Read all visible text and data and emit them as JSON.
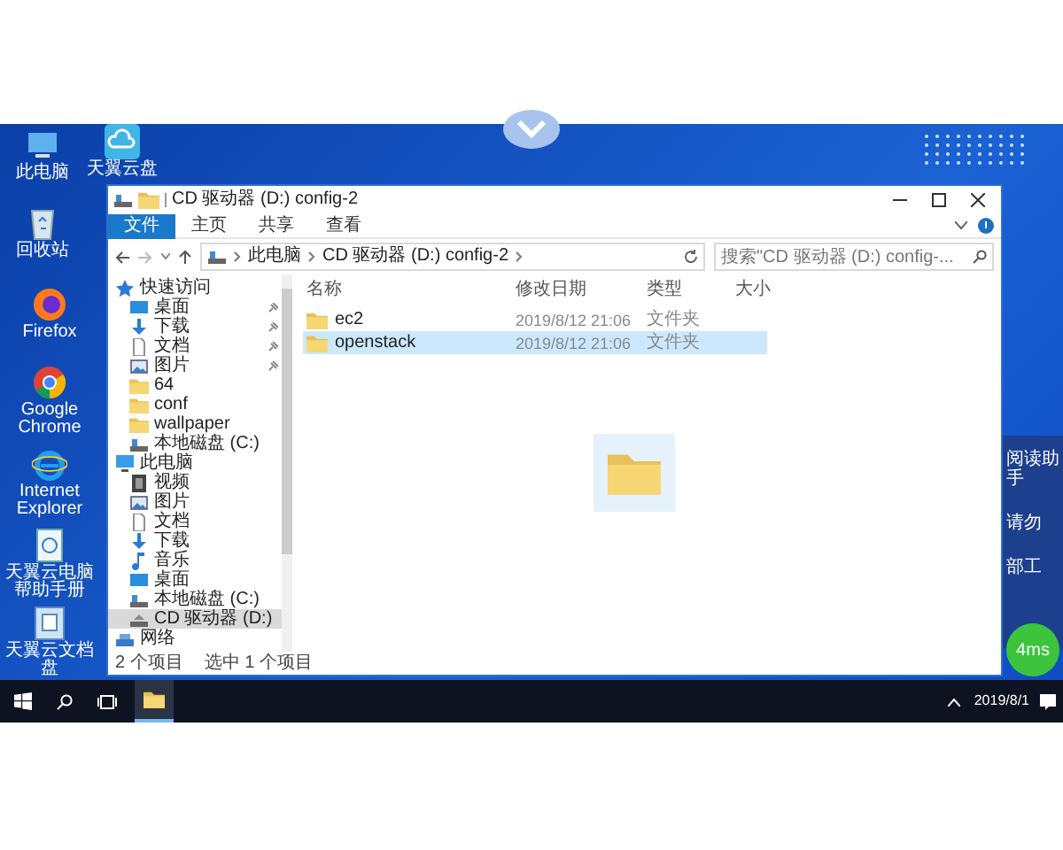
{
  "desktop_icons": [
    {
      "label": "此电脑",
      "kind": "pc"
    },
    {
      "label": "天翼云盘",
      "kind": "cloud"
    },
    {
      "label": "回收站",
      "kind": "bin"
    },
    {
      "label": "Firefox",
      "kind": "firefox"
    },
    {
      "label": "Google Chrome",
      "kind": "chrome"
    },
    {
      "label": "Internet Explorer",
      "kind": "ie"
    },
    {
      "label": "天翼云电脑帮助手册",
      "kind": "manual"
    },
    {
      "label": "天翼云文档盘",
      "kind": "docdisk"
    }
  ],
  "explorer": {
    "title": "CD 驱动器 (D:) config-2",
    "ribbon_tabs": [
      {
        "label": "文件",
        "selected": true
      },
      {
        "label": "主页",
        "selected": false
      },
      {
        "label": "共享",
        "selected": false
      },
      {
        "label": "查看",
        "selected": false
      }
    ],
    "breadcrumb": [
      "此电脑",
      "CD 驱动器 (D:) config-2"
    ],
    "search": {
      "placeholder": "搜索\"CD 驱动器 (D:) config-..."
    },
    "nav": [
      {
        "label": "快速访问",
        "kind": "star",
        "selected": false,
        "children": [
          {
            "label": "桌面",
            "kind": "desktop",
            "pinned": true,
            "selected": false
          },
          {
            "label": "下载",
            "kind": "download",
            "pinned": true,
            "selected": false
          },
          {
            "label": "文档",
            "kind": "doc",
            "pinned": true,
            "selected": false
          },
          {
            "label": "图片",
            "kind": "picture",
            "pinned": true,
            "selected": false
          },
          {
            "label": "64",
            "kind": "folder",
            "pinned": false,
            "selected": false
          },
          {
            "label": "conf",
            "kind": "folder",
            "pinned": false,
            "selected": false
          },
          {
            "label": "wallpaper",
            "kind": "folder",
            "pinned": false,
            "selected": false
          },
          {
            "label": "本地磁盘 (C:)",
            "kind": "drive",
            "pinned": false,
            "selected": false
          }
        ]
      },
      {
        "label": "此电脑",
        "kind": "pc",
        "selected": false,
        "children": [
          {
            "label": "视频",
            "kind": "video",
            "pinned": false,
            "selected": false
          },
          {
            "label": "图片",
            "kind": "picture",
            "pinned": false,
            "selected": false
          },
          {
            "label": "文档",
            "kind": "doc",
            "pinned": false,
            "selected": false
          },
          {
            "label": "下载",
            "kind": "download",
            "pinned": false,
            "selected": false
          },
          {
            "label": "音乐",
            "kind": "music",
            "pinned": false,
            "selected": false
          },
          {
            "label": "桌面",
            "kind": "desktop",
            "pinned": false,
            "selected": false
          },
          {
            "label": "本地磁盘 (C:)",
            "kind": "drive",
            "pinned": false,
            "selected": false
          },
          {
            "label": "CD 驱动器 (D:)",
            "kind": "cd",
            "pinned": false,
            "selected": true
          }
        ]
      },
      {
        "label": "网络",
        "kind": "network",
        "selected": false
      }
    ],
    "columns": [
      "名称",
      "修改日期",
      "类型",
      "大小"
    ],
    "rows": [
      {
        "name": "ec2",
        "modified": "2019/8/12 21:06",
        "type": "文件夹",
        "selected": false
      },
      {
        "name": "openstack",
        "modified": "2019/8/12 21:06",
        "type": "文件夹",
        "selected": true
      }
    ],
    "status": {
      "count": "2 个项目",
      "selection": "选中 1 个项目"
    }
  },
  "side_panel": [
    "阅读助手",
    "请勿",
    "部工"
  ],
  "latency_badge": "4ms",
  "tray_date": "2019/8/1"
}
